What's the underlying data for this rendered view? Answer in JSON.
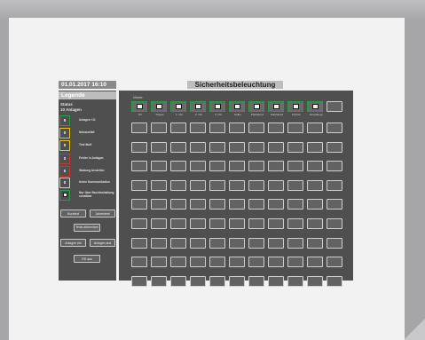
{
  "header": {
    "date_time": "01.01.2017 16:10",
    "title": "Sicherheitsbeleuchtung"
  },
  "legend": {
    "title": "Legende",
    "status_label": "Status",
    "installations": "10 Anlagen",
    "items": [
      {
        "value": "5",
        "text": "Anlagen i.O.",
        "color": "#2e9a45"
      },
      {
        "value": "0",
        "text": "Netzausfall",
        "color": "#e0c419"
      },
      {
        "value": "0",
        "text": "Test läuft",
        "color": "#e0c419"
      },
      {
        "value": "0",
        "text": "Fehler in Anlagen",
        "color": "#c23a2e"
      },
      {
        "value": "0",
        "text": "Wartung bestellen",
        "color": "#c23a2e"
      },
      {
        "value": "0",
        "text": "Keine Kommunikation",
        "color": "#cccccc"
      },
      {
        "value": "",
        "text": "Nur über Nachtschaltung schaltbar",
        "color": "#2e9a45",
        "icon": "lamp-icon"
      }
    ]
  },
  "buttons": {
    "kurztest": "Kurztest",
    "jahrestest": "Jahrestest",
    "tests_abbrechen": "Tests abbrechen",
    "anlagen_ein": "Anlagen ein",
    "anlagen_aus": "Anlagen aus",
    "ru_aus": "RS aus"
  },
  "grid": {
    "section_label": "Master",
    "row1_cells": [
      {
        "label": "SV",
        "icon": "lamp-icon"
      },
      {
        "label": "Treppe",
        "icon": "lamp-icon"
      },
      {
        "label": "1. OG",
        "icon": "lamp-icon"
      },
      {
        "label": "2. OG",
        "icon": "lamp-icon"
      },
      {
        "label": "3. OG",
        "icon": "lamp-icon"
      },
      {
        "label": "Keller",
        "icon": "lamp-icon"
      },
      {
        "label": "Parkhaus1",
        "icon": "lamp-icon"
      },
      {
        "label": "Parkhaus2",
        "icon": "lamp-icon"
      },
      {
        "label": "Küchen",
        "icon": "lamp-icon"
      },
      {
        "label": "Verwaltung",
        "icon": "lamp-icon"
      }
    ],
    "empty_rows": 9,
    "columns": 11
  }
}
